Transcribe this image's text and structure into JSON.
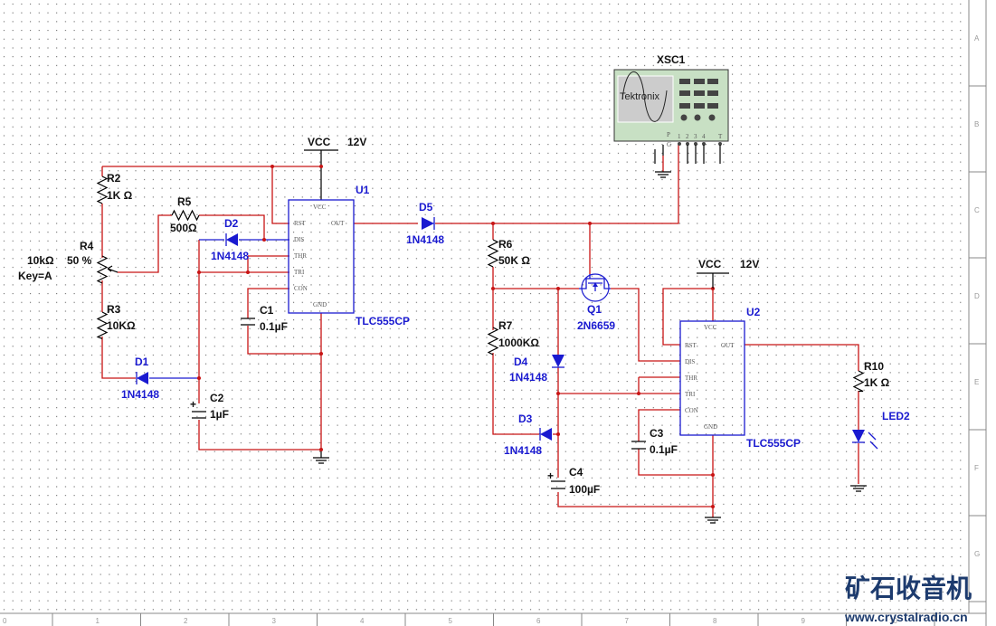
{
  "colors": {
    "wire": "#c81414",
    "component_blue": "#1a1ad0",
    "scope_body": "#c8e0c4"
  },
  "power": [
    {
      "name": "VCC",
      "value": "12V"
    },
    {
      "name": "VCC",
      "value": "12V"
    }
  ],
  "components": {
    "R2": {
      "ref": "R2",
      "value": "1K Ω"
    },
    "R3": {
      "ref": "R3",
      "value": "10KΩ"
    },
    "R4": {
      "ref": "R4",
      "value": "10kΩ",
      "setting": "50 %",
      "key": "Key=A"
    },
    "R5": {
      "ref": "R5",
      "value": "500Ω"
    },
    "R6": {
      "ref": "R6",
      "value": "50K Ω"
    },
    "R7": {
      "ref": "R7",
      "value": "1000KΩ"
    },
    "R10": {
      "ref": "R10",
      "value": "1K Ω"
    },
    "C1": {
      "ref": "C1",
      "value": "0.1µF"
    },
    "C2": {
      "ref": "C2",
      "value": "1µF"
    },
    "C3": {
      "ref": "C3",
      "value": "0.1µF"
    },
    "C4": {
      "ref": "C4",
      "value": "100µF"
    },
    "D1": {
      "ref": "D1",
      "value": "1N4148"
    },
    "D2": {
      "ref": "D2",
      "value": "1N4148"
    },
    "D3": {
      "ref": "D3",
      "value": "1N4148"
    },
    "D4": {
      "ref": "D4",
      "value": "1N4148"
    },
    "D5": {
      "ref": "D5",
      "value": "1N4148"
    },
    "Q1": {
      "ref": "Q1",
      "value": "2N6659"
    },
    "LED2": {
      "ref": "LED2"
    },
    "U1": {
      "ref": "U1",
      "value": "TLC555CP"
    },
    "U2": {
      "ref": "U2",
      "value": "TLC555CP"
    },
    "XSC1": {
      "ref": "XSC1",
      "brand": "Tektronix",
      "probe_pins": [
        "P",
        "G"
      ],
      "channels": [
        "1",
        "2",
        "3",
        "4",
        "T"
      ]
    }
  },
  "ic_pins": [
    "VCC",
    "RST",
    "OUT",
    "DIS",
    "THR",
    "TRI",
    "CON",
    "GND"
  ],
  "ruler": {
    "columns": [
      "0",
      "1",
      "2",
      "3",
      "4",
      "5",
      "6",
      "7",
      "8",
      "9",
      "10"
    ],
    "rows": [
      "A",
      "B",
      "C",
      "D",
      "E",
      "F",
      "G"
    ]
  },
  "watermark": {
    "title": "矿石收音机",
    "url": "www.crystalradio.cn"
  }
}
